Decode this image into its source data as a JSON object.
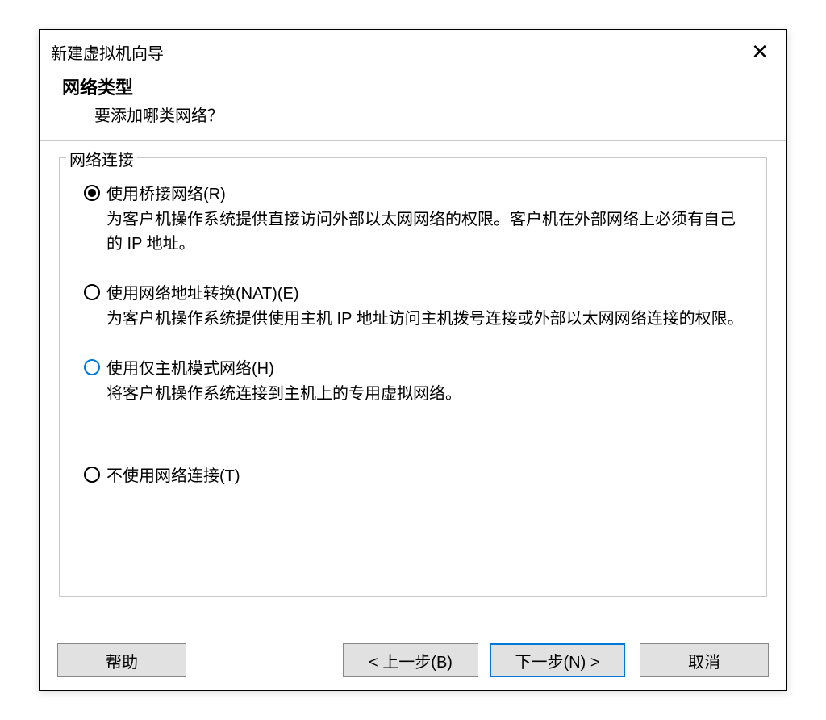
{
  "dialog": {
    "title": "新建虚拟机向导",
    "header_title": "网络类型",
    "header_subtitle": "要添加哪类网络？",
    "groupbox_legend": "网络连接",
    "options": [
      {
        "label": "使用桥接网络(R)",
        "desc": "为客户机操作系统提供直接访问外部以太网网络的权限。客户机在外部网络上必须有自己的 IP 地址。",
        "selected": true,
        "highlight": false
      },
      {
        "label": "使用网络地址转换(NAT)(E)",
        "desc": "为客户机操作系统提供使用主机 IP 地址访问主机拨号连接或外部以太网网络连接的权限。",
        "selected": false,
        "highlight": false
      },
      {
        "label": "使用仅主机模式网络(H)",
        "desc": "将客户机操作系统连接到主机上的专用虚拟网络。",
        "selected": false,
        "highlight": true
      },
      {
        "label": "不使用网络连接(T)",
        "desc": "",
        "selected": false,
        "highlight": false
      }
    ],
    "buttons": {
      "help": "帮助",
      "back": "< 上一步(B)",
      "next": "下一步(N) >",
      "cancel": "取消"
    }
  }
}
